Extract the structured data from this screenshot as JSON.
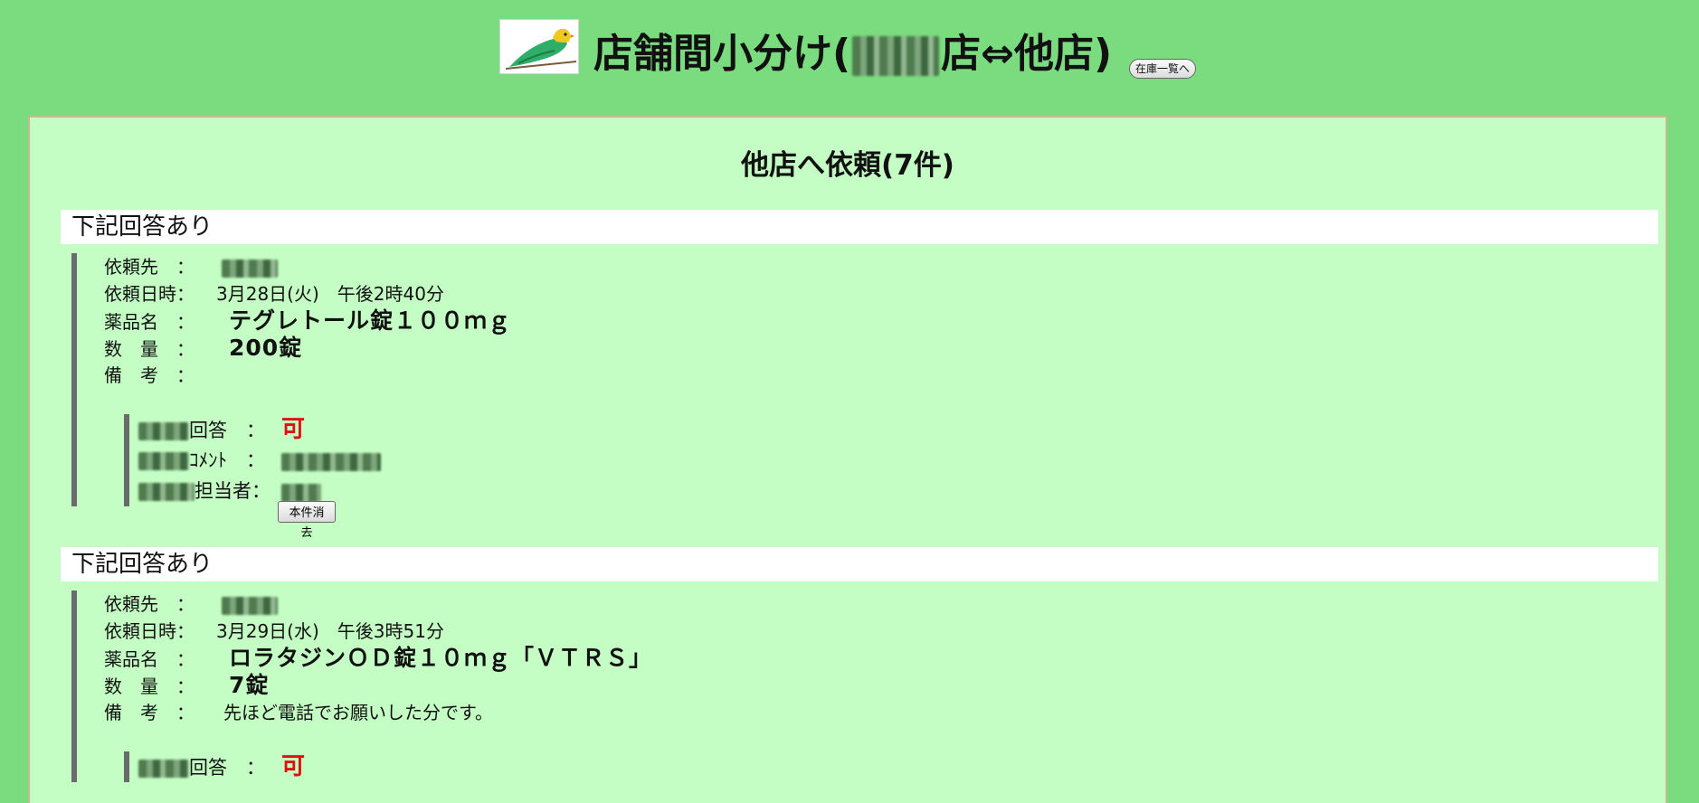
{
  "header": {
    "title_prefix": "店舗間小分け(",
    "title_suffix": "店⇔他店)",
    "stock_button_label": "在庫一覧へ"
  },
  "section": {
    "title": "他店へ依頼(7件)"
  },
  "labels": {
    "dest": "依頼先　：",
    "datetime": "依頼日時：",
    "drug": "薬品名　：",
    "qty": "数　量　：",
    "note": "備　考　：",
    "answer": "回答　：",
    "comment": "ｺﾒﾝﾄ　：",
    "person": "担当者："
  },
  "requests": [
    {
      "status": "下記回答あり",
      "datetime": "3月28日(火)　午後2時40分",
      "drug": "テグレトール錠１００ｍｇ",
      "qty": "200錠",
      "note": "",
      "answer": "可",
      "delete_label": "本件消去"
    },
    {
      "status": "下記回答あり",
      "datetime": "3月29日(水)　午後3時51分",
      "drug": "ロラタジンＯＤ錠１０ｍｇ「ＶＴＲＳ」",
      "qty": "7錠",
      "note": "先ほど電話でお願いした分です。",
      "answer": "可"
    }
  ]
}
